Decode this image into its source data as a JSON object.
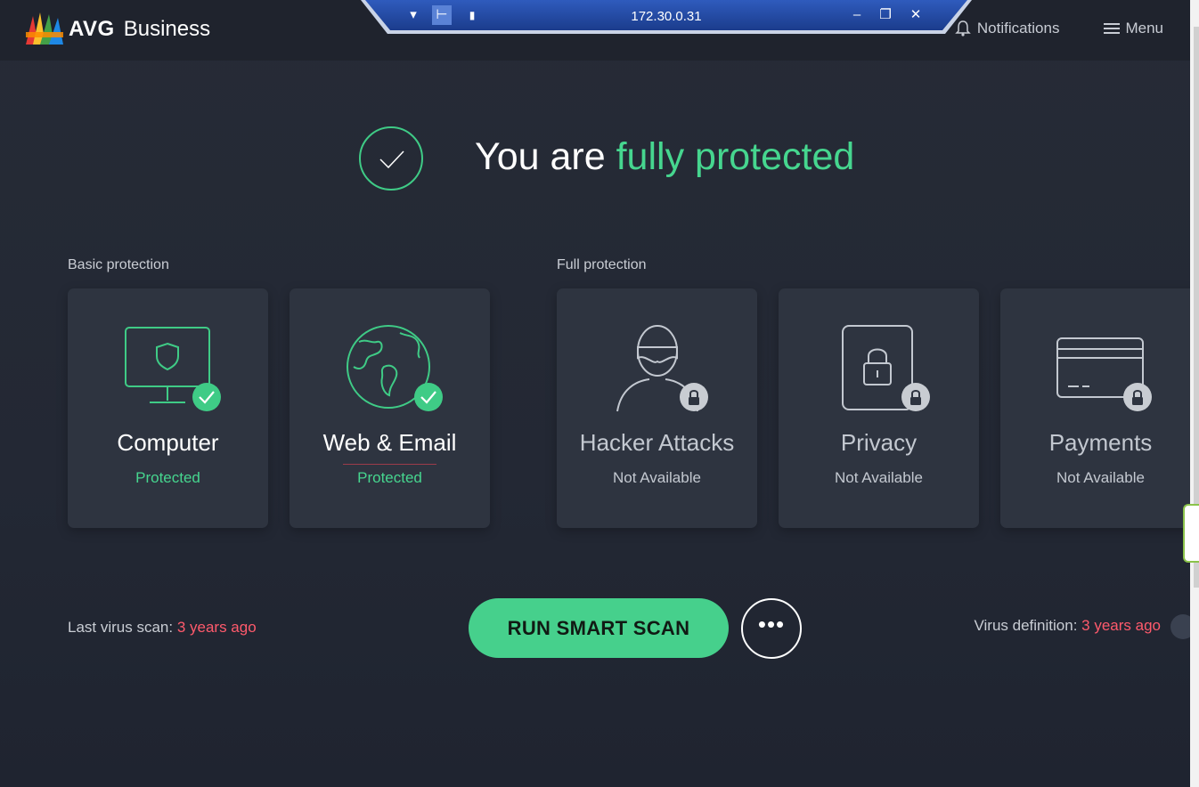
{
  "header": {
    "brand_avg": "AVG",
    "brand_business": "Business",
    "notifications_label": "Notifications",
    "menu_label": "Menu"
  },
  "remote_bar": {
    "ip": "172.30.0.31"
  },
  "status": {
    "prefix": "You are ",
    "highlight": "fully protected"
  },
  "sections": {
    "basic_label": "Basic protection",
    "full_label": "Full protection"
  },
  "cards": [
    {
      "title": "Computer",
      "status": "Protected",
      "icon": "monitor-shield-icon",
      "state": "protected"
    },
    {
      "title": "Web & Email",
      "status": "Protected",
      "icon": "globe-icon",
      "state": "protected"
    },
    {
      "title": "Hacker Attacks",
      "status": "Not Available",
      "icon": "hacker-icon",
      "state": "locked"
    },
    {
      "title": "Privacy",
      "status": "Not Available",
      "icon": "privacy-lock-icon",
      "state": "locked"
    },
    {
      "title": "Payments",
      "status": "Not Available",
      "icon": "credit-card-icon",
      "state": "locked"
    }
  ],
  "footer": {
    "last_scan_label": "Last virus scan: ",
    "last_scan_value": "3 years ago",
    "scan_button": "RUN SMART SCAN",
    "definition_label": "Virus definition: ",
    "definition_value": "3 years ago"
  },
  "colors": {
    "accent_green": "#46d68f",
    "warning_red": "#ff5a6c",
    "background": "#232834",
    "card": "#2e3440"
  }
}
